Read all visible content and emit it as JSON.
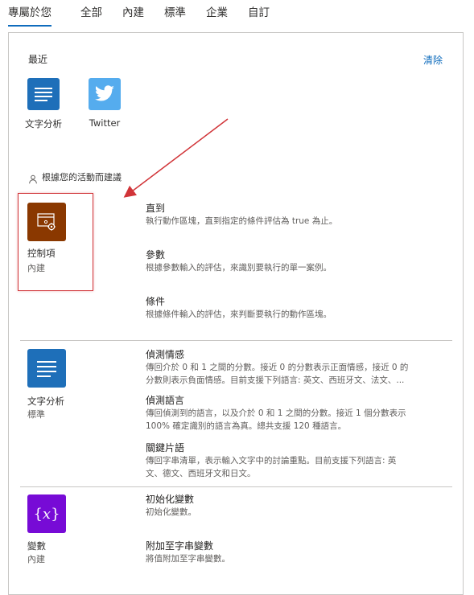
{
  "tabs": [
    "專屬於您",
    "全部",
    "內建",
    "標準",
    "企業",
    "自訂"
  ],
  "recent": {
    "title": "最近",
    "clear": "清除",
    "apps": [
      {
        "label": "文字分析",
        "icon": "text-analytics-icon",
        "color": "#1e6fb9"
      },
      {
        "label": "Twitter",
        "icon": "twitter-bird-icon",
        "color": "#55acee"
      }
    ]
  },
  "suggested": {
    "label": "根據您的活動而建議",
    "icon": "person-icon"
  },
  "connectors": [
    {
      "name": "控制項",
      "type": "內建",
      "icon": "control-icon",
      "color": "#8a3800",
      "actions": [
        {
          "title": "直到",
          "desc": [
            "執行動作區塊，直到指定的條件評估為 true 為止。"
          ]
        },
        {
          "title": "參數",
          "desc": [
            "根據參數輸入的評估，來識別要執行的單一案例。"
          ]
        },
        {
          "title": "條件",
          "desc": [
            "根據條件輸入的評估，來判斷要執行的動作區塊。"
          ]
        }
      ]
    },
    {
      "name": "文字分析",
      "type": "標準",
      "icon": "text-analytics-icon",
      "color": "#1e6fb9",
      "actions": [
        {
          "title": "偵測情感",
          "desc": [
            "傳回介於 0 和 1 之間的分數。接近 0 的分數表示正面情感，接近 0 的",
            "分數則表示負面情感。目前支援下列語言: 英文、西班牙文、法文、..."
          ]
        },
        {
          "title": "偵測語言",
          "desc": [
            "傳回偵測到的語言，以及介於 0 和 1 之間的分數。接近 1 個分數表示",
            "100% 確定識別的語言為真。總共支援 120 種語言。"
          ]
        },
        {
          "title": "關鍵片語",
          "desc": [
            "傳回字串清單，表示輸入文字中的討論重點。目前支援下列語言: 英",
            "文、德文、西班牙文和日文。"
          ]
        }
      ]
    },
    {
      "name": "變數",
      "type": "內建",
      "icon": "variable-icon",
      "color": "#770bd6",
      "actions": [
        {
          "title": "初始化變數",
          "desc": [
            "初始化變數。"
          ]
        },
        {
          "title": "附加至字串變數",
          "desc": [
            "將值附加至字串變數。"
          ]
        }
      ]
    }
  ],
  "annotation": {
    "color": "#d13438"
  }
}
